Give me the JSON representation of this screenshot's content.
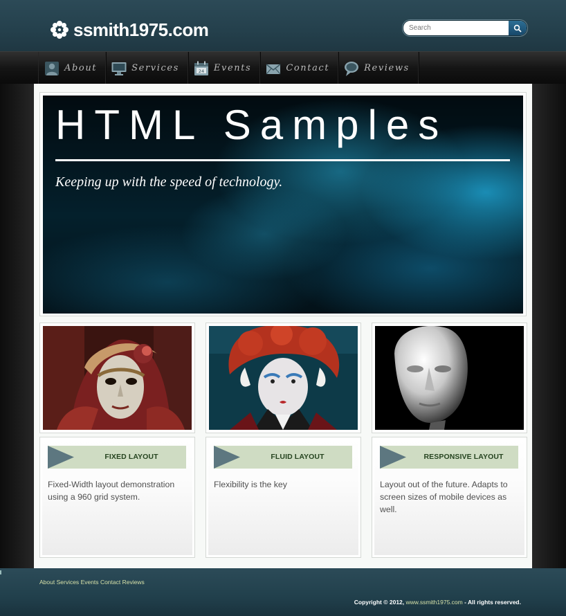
{
  "header": {
    "logo_text": "ssmith1975.com",
    "logo_icon": "flower-icon",
    "search_placeholder": "Search",
    "search_icon": "search-icon"
  },
  "nav": {
    "items": [
      {
        "label": "About",
        "icon": "person-icon"
      },
      {
        "label": "Services",
        "icon": "monitor-icon"
      },
      {
        "label": "Events",
        "icon": "calendar-icon"
      },
      {
        "label": "Contact",
        "icon": "envelope-icon"
      },
      {
        "label": "Reviews",
        "icon": "speech-bubble-icon"
      }
    ]
  },
  "hero": {
    "title": "HTML Samples",
    "subtitle": "Keeping up with the speed of technology."
  },
  "cards": [
    {
      "title": "FIXED LAYOUT",
      "text": "Fixed-Width layout demonstration using a 960 grid system.",
      "image": "venetian-mask-photo"
    },
    {
      "title": "FLUID LAYOUT",
      "text": "Flexibility is the key",
      "image": "red-queen-costume-photo"
    },
    {
      "title": "RESPONSIVE LAYOUT",
      "text": "Layout out of the future. Adapts to screen sizes of mobile devices as well.",
      "image": "mannequin-head-photo"
    }
  ],
  "footer": {
    "links": [
      "About",
      "Services",
      "Events",
      "Contact",
      "Reviews"
    ],
    "copyright_prefix": "Copyright © 2012,",
    "copyright_site": "www.ssmith1975.com",
    "copyright_suffix": "- All rights reserved."
  },
  "colors": {
    "header_bg": "#24404c",
    "nav_bg": "#151515",
    "card_head_bg": "#cfdcc3",
    "card_arrow": "#5d7780",
    "card_title": "#264420",
    "footer_link": "#d5e0a8"
  }
}
